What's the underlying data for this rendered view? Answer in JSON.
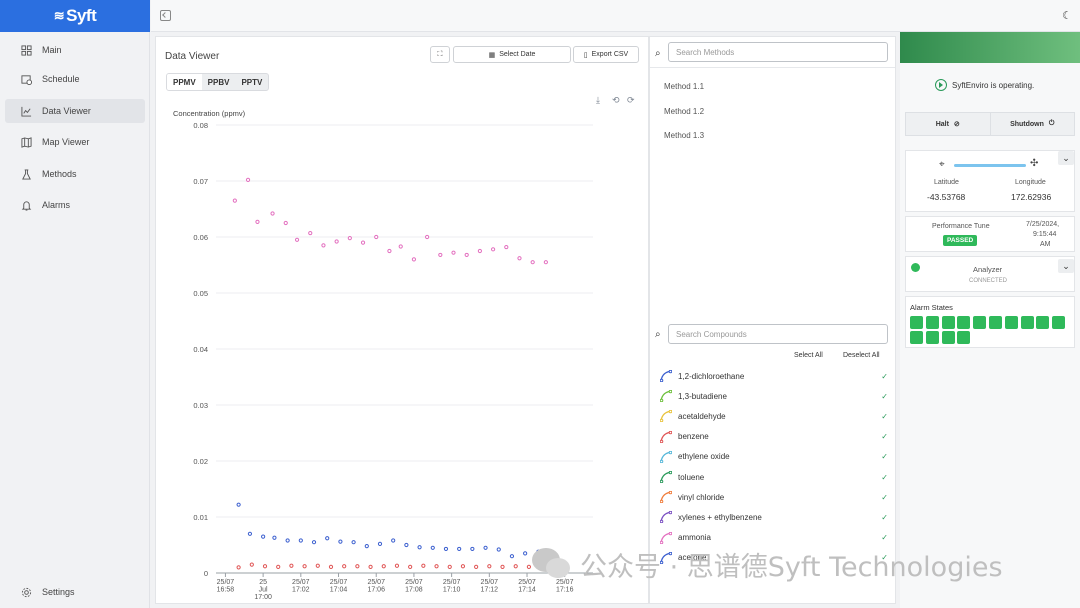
{
  "brand": {
    "name": "Syft"
  },
  "sidebar": {
    "items": [
      {
        "label": "Main",
        "icon": "grid-icon",
        "active": false
      },
      {
        "label": "Schedule",
        "icon": "calendar-clock-icon",
        "active": false
      },
      {
        "label": "Data Viewer",
        "icon": "line-chart-icon",
        "active": true
      },
      {
        "label": "Map Viewer",
        "icon": "map-icon",
        "active": false
      },
      {
        "label": "Methods",
        "icon": "flask-icon",
        "active": false
      },
      {
        "label": "Alarms",
        "icon": "bell-icon",
        "active": false
      }
    ],
    "settings_label": "Settings"
  },
  "data_viewer": {
    "title": "Data Viewer",
    "expand_icon": "expand-icon",
    "select_date_label": "Select Date",
    "export_label": "Export CSV",
    "units": [
      {
        "label": "PPMV",
        "selected": true
      },
      {
        "label": "PPBV",
        "selected": false
      },
      {
        "label": "PPTV",
        "selected": false
      }
    ]
  },
  "chart_data": {
    "type": "scatter",
    "ylabel": "Concentration (ppmv)",
    "ylim": [
      0,
      0.08
    ],
    "yticks": [
      "0.08",
      "0.07",
      "0.06",
      "0.05",
      "0.04",
      "0.03",
      "0.02",
      "0.01",
      "0"
    ],
    "xlim": [
      0,
      20
    ],
    "x_ticks": [
      {
        "x": 0.5,
        "label": [
          "25/07",
          "16:58"
        ]
      },
      {
        "x": 2.5,
        "label": [
          "25",
          "Jul",
          "17:00"
        ]
      },
      {
        "x": 4.5,
        "label": [
          "25/07",
          "17:02"
        ]
      },
      {
        "x": 6.5,
        "label": [
          "25/07",
          "17:04"
        ]
      },
      {
        "x": 8.5,
        "label": [
          "25/07",
          "17:06"
        ]
      },
      {
        "x": 10.5,
        "label": [
          "25/07",
          "17:08"
        ]
      },
      {
        "x": 12.5,
        "label": [
          "25/07",
          "17:10"
        ]
      },
      {
        "x": 14.5,
        "label": [
          "25/07",
          "17:12"
        ]
      },
      {
        "x": 16.5,
        "label": [
          "25/07",
          "17:14"
        ]
      },
      {
        "x": 18.5,
        "label": [
          "25/07",
          "17:16"
        ]
      }
    ],
    "series": [
      {
        "color": "#e36fbf",
        "points": [
          [
            1.0,
            0.0665
          ],
          [
            1.7,
            0.0702
          ],
          [
            2.2,
            0.0627
          ],
          [
            3.0,
            0.0642
          ],
          [
            3.7,
            0.0625
          ],
          [
            4.3,
            0.0595
          ],
          [
            5.0,
            0.0607
          ],
          [
            5.7,
            0.0585
          ],
          [
            6.4,
            0.0592
          ],
          [
            7.1,
            0.0598
          ],
          [
            7.8,
            0.059
          ],
          [
            8.5,
            0.06
          ],
          [
            9.2,
            0.0575
          ],
          [
            9.8,
            0.0583
          ],
          [
            10.5,
            0.056
          ],
          [
            11.2,
            0.06
          ],
          [
            11.9,
            0.0568
          ],
          [
            12.6,
            0.0572
          ],
          [
            13.3,
            0.0568
          ],
          [
            14.0,
            0.0575
          ],
          [
            14.7,
            0.0578
          ],
          [
            15.4,
            0.0582
          ],
          [
            16.1,
            0.0562
          ],
          [
            16.8,
            0.0555
          ],
          [
            17.5,
            0.0555
          ]
        ]
      },
      {
        "color": "#3b5fcf",
        "points": [
          [
            1.2,
            0.0122
          ],
          [
            1.8,
            0.007
          ],
          [
            2.5,
            0.0065
          ],
          [
            3.1,
            0.0063
          ],
          [
            3.8,
            0.0058
          ],
          [
            4.5,
            0.0058
          ],
          [
            5.2,
            0.0055
          ],
          [
            5.9,
            0.0062
          ],
          [
            6.6,
            0.0056
          ],
          [
            7.3,
            0.0055
          ],
          [
            8.0,
            0.0048
          ],
          [
            8.7,
            0.0052
          ],
          [
            9.4,
            0.0058
          ],
          [
            10.1,
            0.005
          ],
          [
            10.8,
            0.0046
          ],
          [
            11.5,
            0.0045
          ],
          [
            12.2,
            0.0043
          ],
          [
            12.9,
            0.0043
          ],
          [
            13.6,
            0.0043
          ],
          [
            14.3,
            0.0045
          ],
          [
            15.0,
            0.0042
          ],
          [
            15.7,
            0.003
          ],
          [
            16.4,
            0.0035
          ],
          [
            17.1,
            0.0038
          ],
          [
            17.8,
            0.0037
          ]
        ]
      },
      {
        "color": "#e05555",
        "points": [
          [
            1.2,
            0.001
          ],
          [
            1.9,
            0.0015
          ],
          [
            2.6,
            0.0012
          ],
          [
            3.3,
            0.0011
          ],
          [
            4.0,
            0.0013
          ],
          [
            4.7,
            0.0012
          ],
          [
            5.4,
            0.0013
          ],
          [
            6.1,
            0.0011
          ],
          [
            6.8,
            0.0012
          ],
          [
            7.5,
            0.0012
          ],
          [
            8.2,
            0.0011
          ],
          [
            8.9,
            0.0012
          ],
          [
            9.6,
            0.0013
          ],
          [
            10.3,
            0.0011
          ],
          [
            11.0,
            0.0013
          ],
          [
            11.7,
            0.0012
          ],
          [
            12.4,
            0.0011
          ],
          [
            13.1,
            0.0012
          ],
          [
            13.8,
            0.0011
          ],
          [
            14.5,
            0.0012
          ],
          [
            15.2,
            0.0011
          ],
          [
            15.9,
            0.0012
          ],
          [
            16.6,
            0.0011
          ],
          [
            17.3,
            0.0012
          ],
          [
            17.9,
            0.0012
          ]
        ]
      }
    ]
  },
  "methods": {
    "search_placeholder": "Search Methods",
    "items": [
      "Method 1.1",
      "Method 1.2",
      "Method 1.3"
    ]
  },
  "compounds": {
    "search_placeholder": "Search Compounds",
    "select_all": "Select All",
    "deselect_all": "Deselect All",
    "items": [
      {
        "name": "1,2-dichloroethane",
        "color": "#3b5fcf"
      },
      {
        "name": "1,3-butadiene",
        "color": "#6cbf3a"
      },
      {
        "name": "acetaldehyde",
        "color": "#e8c23a"
      },
      {
        "name": "benzene",
        "color": "#e05555"
      },
      {
        "name": "ethylene oxide",
        "color": "#55b7d9"
      },
      {
        "name": "toluene",
        "color": "#2a9a5a"
      },
      {
        "name": "vinyl chloride",
        "color": "#f07c3a"
      },
      {
        "name": "xylenes + ethylbenzene",
        "color": "#7a4fc2"
      },
      {
        "name": "ammonia",
        "color": "#e36fbf"
      },
      {
        "name": "acetone",
        "color": "#3b5fcf"
      }
    ]
  },
  "status": {
    "operating": "SyftEnviro is operating.",
    "halt": "Halt",
    "shutdown": "Shutdown",
    "lat_label": "Latitude",
    "lat": "-43.53768",
    "lon_label": "Longitude",
    "lon": "172.62936",
    "perf_label": "Performance Tune",
    "perf_status": "PASSED",
    "perf_date": "7/25/2024,",
    "perf_time": "9:15:44",
    "perf_ampm": "AM",
    "analyzer": "Analyzer",
    "analyzer_state": "CONNECTED",
    "alarm_label": "Alarm States",
    "alarm_count": 14,
    "alarm_color": "#2fb95a"
  },
  "watermark": "公众号 · 思谱德Syft Technologies"
}
